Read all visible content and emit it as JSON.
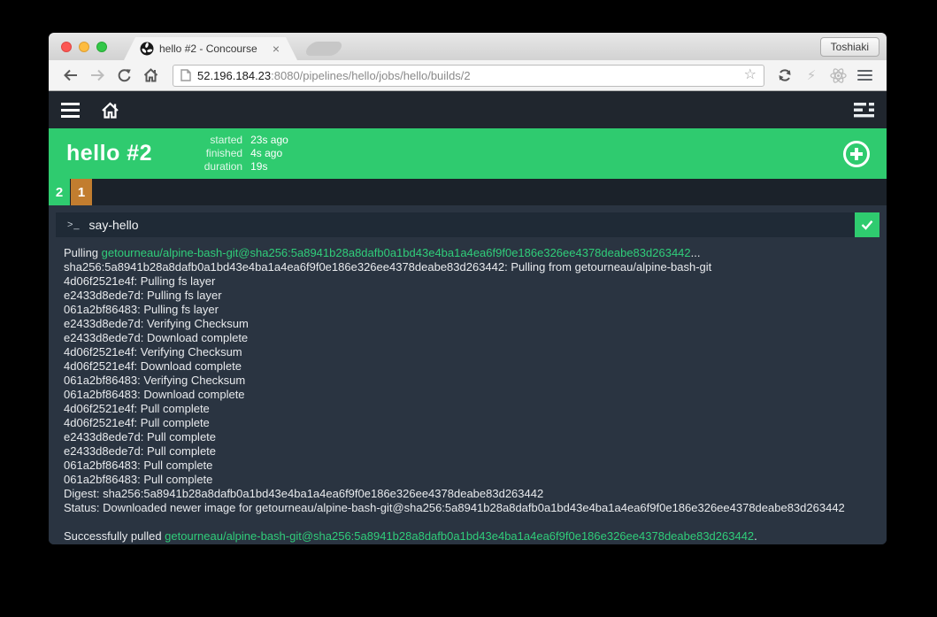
{
  "colors": {
    "accent_green": "#2fcb6f",
    "build_errored_orange": "#c27d2f",
    "log_green": "#30cd7a",
    "navbar_dark": "#20262e",
    "content_dark": "#2a3441"
  },
  "window": {
    "profile_button": "Toshiaki"
  },
  "browser": {
    "tab": {
      "title": "hello #2 - Concourse",
      "close_glyph": "×"
    },
    "url": {
      "host": "52.196.184.23",
      "path": ":8080/pipelines/hello/jobs/hello/builds/2"
    },
    "glyphs": {
      "star": "☆",
      "lightning": "⚡"
    }
  },
  "build_header": {
    "title": "hello #2",
    "meta": [
      {
        "label": "started",
        "value": "23s ago"
      },
      {
        "label": "finished",
        "value": "4s ago"
      },
      {
        "label": "duration",
        "value": "19s"
      }
    ]
  },
  "build_tabs": [
    {
      "number": "2",
      "status": "succeeded",
      "color": "#2fcb6f"
    },
    {
      "number": "1",
      "status": "errored",
      "color": "#c27d2f"
    }
  ],
  "step": {
    "prompt_glyph": ">_",
    "name": "say-hello",
    "status": "succeeded"
  },
  "log_lines": [
    {
      "parts": [
        [
          "Pulling ",
          "fg"
        ],
        [
          "getourneau/alpine-bash-git@sha256:5a8941b28a8dafb0a1bd43e4ba1a4ea6f9f0e186e326ee4378deabe83d263442",
          "green"
        ],
        [
          "...",
          "fg"
        ]
      ]
    },
    {
      "parts": [
        [
          "sha256:5a8941b28a8dafb0a1bd43e4ba1a4ea6f9f0e186e326ee4378deabe83d263442: Pulling from getourneau/alpine-bash-git",
          "fg"
        ]
      ]
    },
    {
      "parts": [
        [
          "4d06f2521e4f: Pulling fs layer",
          "fg"
        ]
      ]
    },
    {
      "parts": [
        [
          "e2433d8ede7d: Pulling fs layer",
          "fg"
        ]
      ]
    },
    {
      "parts": [
        [
          "061a2bf86483: Pulling fs layer",
          "fg"
        ]
      ]
    },
    {
      "parts": [
        [
          "e2433d8ede7d: Verifying Checksum",
          "fg"
        ]
      ]
    },
    {
      "parts": [
        [
          "e2433d8ede7d: Download complete",
          "fg"
        ]
      ]
    },
    {
      "parts": [
        [
          "4d06f2521e4f: Verifying Checksum",
          "fg"
        ]
      ]
    },
    {
      "parts": [
        [
          "4d06f2521e4f: Download complete",
          "fg"
        ]
      ]
    },
    {
      "parts": [
        [
          "061a2bf86483: Verifying Checksum",
          "fg"
        ]
      ]
    },
    {
      "parts": [
        [
          "061a2bf86483: Download complete",
          "fg"
        ]
      ]
    },
    {
      "parts": [
        [
          "4d06f2521e4f: Pull complete",
          "fg"
        ]
      ]
    },
    {
      "parts": [
        [
          "4d06f2521e4f: Pull complete",
          "fg"
        ]
      ]
    },
    {
      "parts": [
        [
          "e2433d8ede7d: Pull complete",
          "fg"
        ]
      ]
    },
    {
      "parts": [
        [
          "e2433d8ede7d: Pull complete",
          "fg"
        ]
      ]
    },
    {
      "parts": [
        [
          "061a2bf86483: Pull complete",
          "fg"
        ]
      ]
    },
    {
      "parts": [
        [
          "061a2bf86483: Pull complete",
          "fg"
        ]
      ]
    },
    {
      "parts": [
        [
          "Digest: sha256:5a8941b28a8dafb0a1bd43e4ba1a4ea6f9f0e186e326ee4378deabe83d263442",
          "fg"
        ]
      ]
    },
    {
      "parts": [
        [
          "Status: Downloaded newer image for getourneau/alpine-bash-git@sha256:5a8941b28a8dafb0a1bd43e4ba1a4ea6f9f0e186e326ee4378deabe83d263442",
          "fg"
        ]
      ]
    },
    {
      "parts": [
        [
          "",
          "fg"
        ]
      ]
    },
    {
      "parts": [
        [
          "Successfully pulled ",
          "fg"
        ],
        [
          "getourneau/alpine-bash-git@sha256:5a8941b28a8dafb0a1bd43e4ba1a4ea6f9f0e186e326ee4378deabe83d263442",
          "green"
        ],
        [
          ".",
          "fg"
        ]
      ]
    }
  ]
}
